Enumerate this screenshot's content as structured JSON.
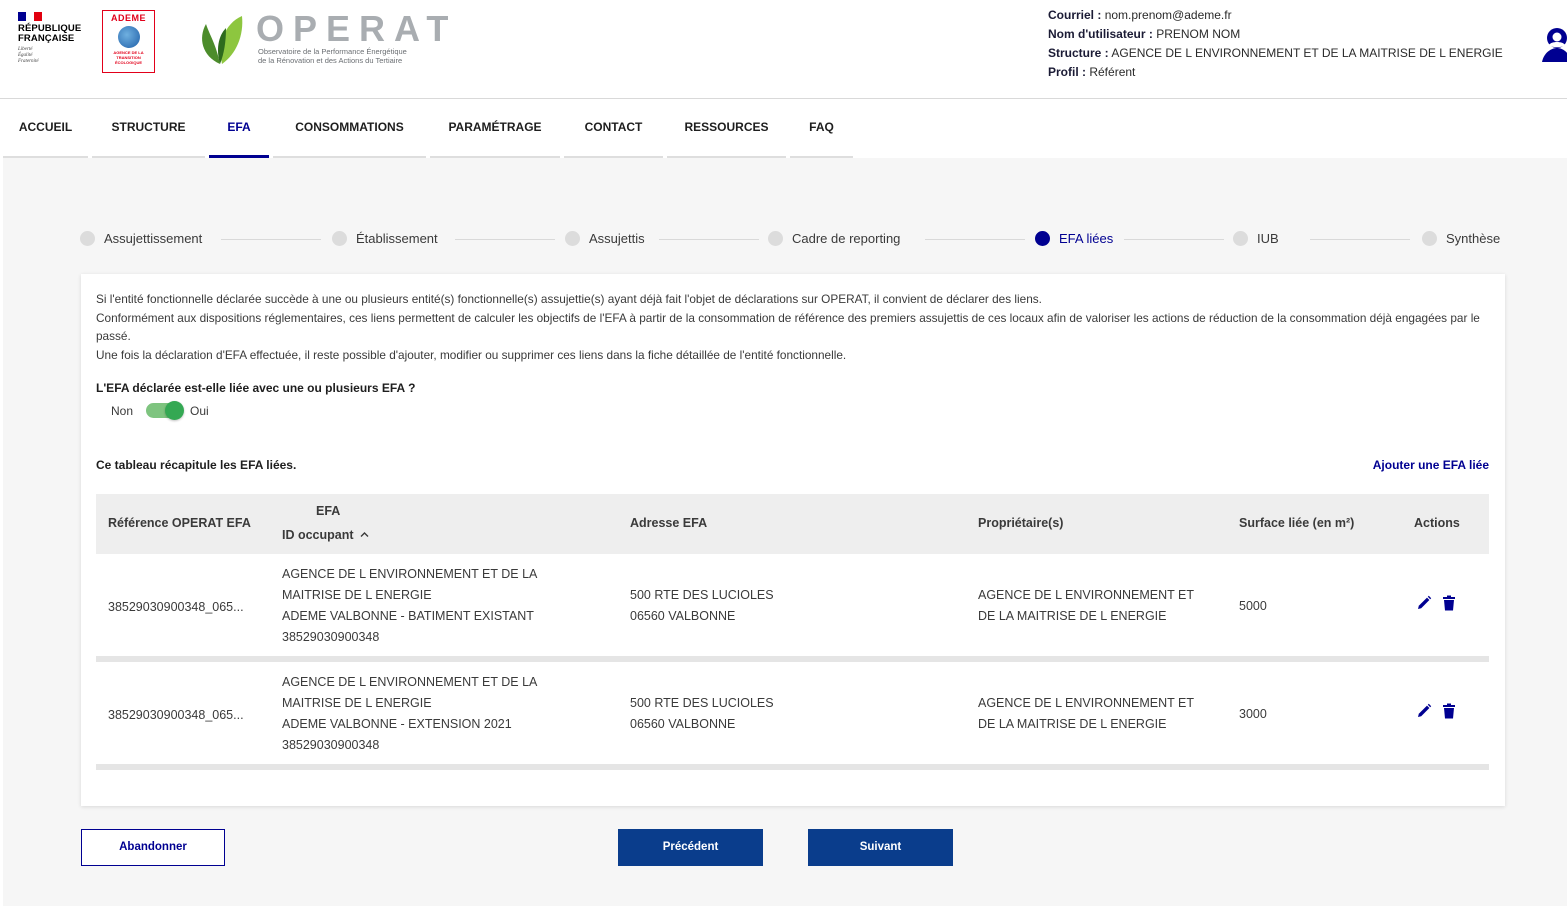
{
  "header": {
    "marianne": {
      "line1": "RÉPUBLIQUE",
      "line2": "FRANÇAISE",
      "devise": [
        "Liberté",
        "Égalité",
        "Fraternité"
      ]
    },
    "ademe": {
      "title": "ADEME",
      "subtitle": [
        "AGENCE DE LA",
        "TRANSITION",
        "ÉCOLOGIQUE"
      ]
    },
    "operat": {
      "name": "OPERAT",
      "subtitle_line1": "Observatoire de la Performance Énergétique",
      "subtitle_line2": "de la Rénovation et des Actions du Tertiaire"
    },
    "user": {
      "courriel_label": "Courriel :",
      "courriel": "nom.prenom@ademe.fr",
      "username_label": "Nom d'utilisateur :",
      "username": "PRENOM NOM",
      "structure_label": "Structure :",
      "structure": "AGENCE DE L ENVIRONNEMENT ET DE LA MAITRISE DE L ENERGIE",
      "profil_label": "Profil :",
      "profil": "Référent"
    }
  },
  "nav": {
    "items": [
      "ACCUEIL",
      "STRUCTURE",
      "EFA",
      "CONSOMMATIONS",
      "PARAMÉTRAGE",
      "CONTACT",
      "RESSOURCES",
      "FAQ"
    ],
    "active": "EFA"
  },
  "stepper": {
    "steps": [
      "Assujettissement",
      "Établissement",
      "Assujettis",
      "Cadre de reporting",
      "EFA liées",
      "IUB",
      "Synthèse"
    ],
    "active": "EFA liées"
  },
  "intro": [
    "Si l'entité fonctionnelle déclarée succède à une ou plusieurs entité(s) fonctionnelle(s) assujettie(s) ayant déjà fait l'objet de déclarations sur OPERAT, il convient de déclarer des liens.",
    "Conformément aux dispositions réglementaires, ces liens permettent de calculer les objectifs de l'EFA à partir de la consommation de référence des premiers assujettis de ces locaux afin de valoriser les actions de réduction de la consommation déjà engagées par le passé.",
    "Une fois la déclaration d'EFA effectuée, il reste possible d'ajouter, modifier ou supprimer ces liens dans la fiche détaillée de l'entité fonctionnelle."
  ],
  "question": "L'EFA déclarée est-elle liée avec une ou plusieurs EFA ?",
  "toggle": {
    "off_label": "Non",
    "on_label": "Oui",
    "value": true
  },
  "table": {
    "title": "Ce tableau récapitule les EFA liées.",
    "add_link": "Ajouter une EFA liée",
    "headers": {
      "ref": "Référence OPERAT EFA",
      "efa": "EFA",
      "id_occupant": "ID occupant",
      "sort_icon": "chevron-up",
      "adresse": "Adresse EFA",
      "proprietaire": "Propriétaire(s)",
      "surface": "Surface liée (en m²)",
      "actions": "Actions"
    },
    "rows": [
      {
        "ref": "38529030900348_065...",
        "efa_org": [
          "AGENCE DE L ENVIRONNEMENT ET DE LA",
          "MAITRISE DE L ENERGIE"
        ],
        "efa_name": "ADEME VALBONNE - BATIMENT EXISTANT",
        "efa_id": "38529030900348",
        "adresse": [
          "500 RTE DES LUCIOLES",
          "06560 VALBONNE"
        ],
        "proprietaire": [
          "AGENCE DE L ENVIRONNEMENT ET",
          "DE LA MAITRISE DE L ENERGIE"
        ],
        "surface": "5000"
      },
      {
        "ref": "38529030900348_065...",
        "efa_org": [
          "AGENCE DE L ENVIRONNEMENT ET DE LA",
          "MAITRISE DE L ENERGIE"
        ],
        "efa_name": "ADEME VALBONNE - EXTENSION 2021",
        "efa_id": "38529030900348",
        "adresse": [
          "500 RTE DES LUCIOLES",
          "06560 VALBONNE"
        ],
        "proprietaire": [
          "AGENCE DE L ENVIRONNEMENT ET",
          "DE LA MAITRISE DE L ENERGIE"
        ],
        "surface": "3000"
      }
    ]
  },
  "buttons": {
    "abandon": "Abandonner",
    "prev": "Précédent",
    "next": "Suivant"
  },
  "colors": {
    "primary": "#000091",
    "button": "#0a3d8c",
    "toggle": "#34a853",
    "marianne_red": "#e1000f",
    "ademe_red": "#e2001a"
  }
}
